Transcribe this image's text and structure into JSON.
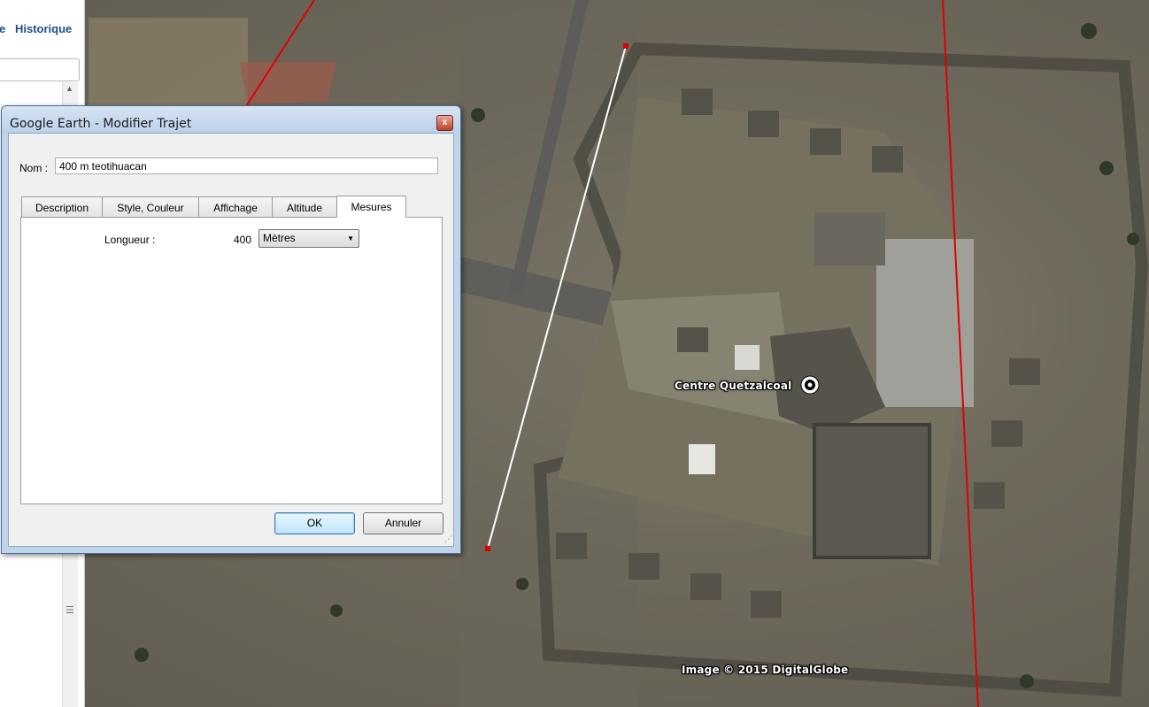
{
  "side_panel": {
    "link_partial": "e",
    "link_history": "Historique"
  },
  "map": {
    "place_label": "Centre Quetzalcoal",
    "copyright": "Image © 2015 DigitalGlobe"
  },
  "dialog": {
    "title": "Google Earth - Modifier Trajet",
    "name_label": "Nom :",
    "name_value": "400 m teotihuacan",
    "tabs": [
      {
        "label": "Description"
      },
      {
        "label": "Style, Couleur"
      },
      {
        "label": "Affichage"
      },
      {
        "label": "Altitude"
      },
      {
        "label": "Mesures"
      }
    ],
    "active_tab": "Mesures",
    "measures": {
      "length_label": "Longueur :",
      "length_value": "400",
      "unit_selected": "Mètres"
    },
    "ok_label": "OK",
    "cancel_label": "Annuler",
    "close_label": "x"
  },
  "colors": {
    "path_line": "#ffffff",
    "red_lines": "#e00000",
    "link_blue": "#1f4e8c"
  }
}
